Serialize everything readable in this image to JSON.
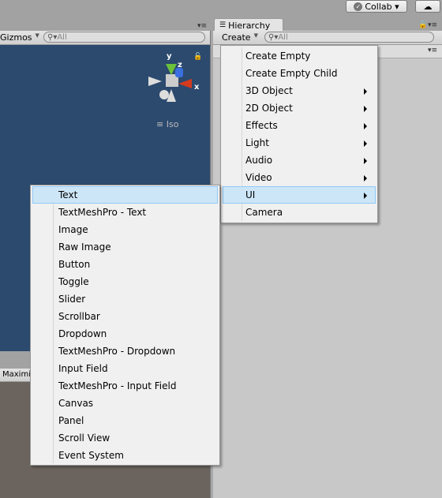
{
  "top": {
    "collab_label": "Collab ▾",
    "cloud_icon": "cloud-icon"
  },
  "scene": {
    "gizmos_label": "Gizmos",
    "search_placeholder": "All",
    "iso_label": "Iso",
    "axis_labels": {
      "x": "x",
      "y": "y",
      "z": "z"
    },
    "maximize_tab": "Maximi"
  },
  "hierarchy": {
    "tab_label": "Hierarchy",
    "create_label": "Create",
    "search_placeholder": "All"
  },
  "create_menu": {
    "items": [
      {
        "label": "Create Empty",
        "submenu": false
      },
      {
        "label": "Create Empty Child",
        "submenu": false
      },
      {
        "label": "3D Object",
        "submenu": true
      },
      {
        "label": "2D Object",
        "submenu": true
      },
      {
        "label": "Effects",
        "submenu": true
      },
      {
        "label": "Light",
        "submenu": true
      },
      {
        "label": "Audio",
        "submenu": true
      },
      {
        "label": "Video",
        "submenu": true
      },
      {
        "label": "UI",
        "submenu": true,
        "highlighted": true
      },
      {
        "label": "Camera",
        "submenu": false
      }
    ]
  },
  "ui_submenu": {
    "items": [
      "Text",
      "TextMeshPro - Text",
      "Image",
      "Raw Image",
      "Button",
      "Toggle",
      "Slider",
      "Scrollbar",
      "Dropdown",
      "TextMeshPro - Dropdown",
      "Input Field",
      "TextMeshPro - Input Field",
      "Canvas",
      "Panel",
      "Scroll View",
      "Event System"
    ],
    "highlighted_index": 0
  },
  "colors": {
    "scene_bg": "#2c4a6e",
    "highlight": "#cde6f7",
    "game_bg": "#6b645e"
  }
}
